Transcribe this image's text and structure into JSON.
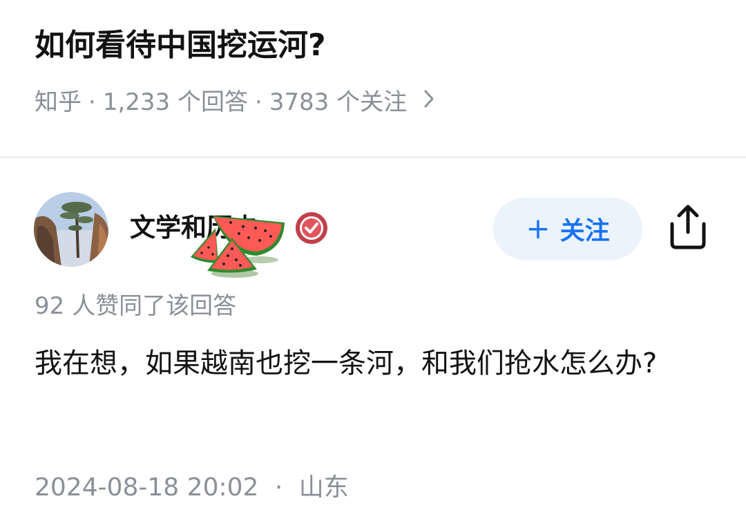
{
  "question": {
    "title": "如何看待中国挖运河?",
    "source": "知乎",
    "answers_count": "1,233 个回答",
    "followers_count": "3783 个关注",
    "separator": "·",
    "chevron_icon": "chevron-right-icon"
  },
  "answer": {
    "author_name": "文学和历史",
    "author_badge_icon": "verified-badge-icon",
    "follow_button_label": "关注",
    "follow_button_icon": "plus-icon",
    "share_icon": "share-icon",
    "like_summary": "92 人赞同了该回答",
    "body": "我在想，如果越南也挖一条河，和我们抢水怎么办?",
    "datetime": "2024-08-18 20:02",
    "separator": "·",
    "location": "山东"
  },
  "colors": {
    "title": "#121212",
    "meta": "#8a8f99",
    "accent": "#1772f6",
    "follow_bg": "#ebf3fc",
    "badge": "#c2404a"
  }
}
